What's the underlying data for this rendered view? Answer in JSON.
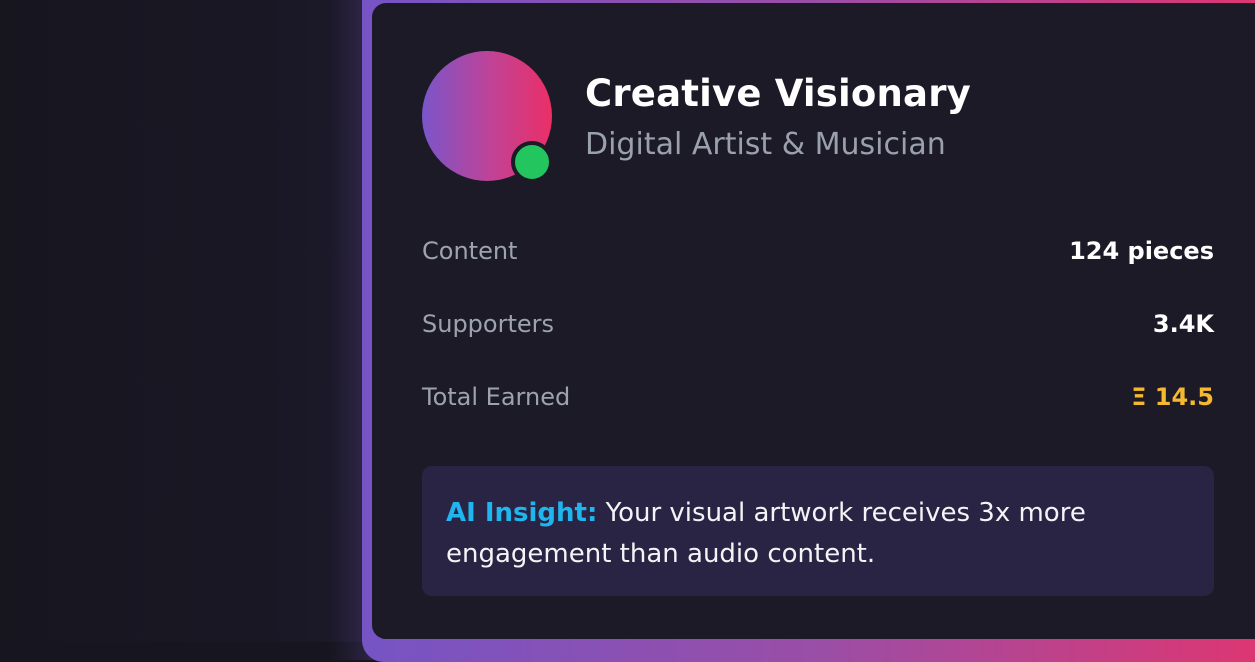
{
  "profile": {
    "name": "Creative Visionary",
    "tagline": "Digital Artist & Musician",
    "status_color": "#22c55e"
  },
  "stats": {
    "content": {
      "label": "Content",
      "value": "124 pieces"
    },
    "supporters": {
      "label": "Supporters",
      "value": "3.4K"
    },
    "earned": {
      "label": "Total Earned",
      "value": "Ξ 14.5"
    }
  },
  "insight": {
    "label": "AI Insight:",
    "text": "Your visual artwork receives 3x more engagement than audio content."
  },
  "colors": {
    "accent_gradient": [
      "#7654c4",
      "#e0356f"
    ],
    "earned_color": "#f5b82e",
    "insight_label_color": "#1fb6ee"
  }
}
